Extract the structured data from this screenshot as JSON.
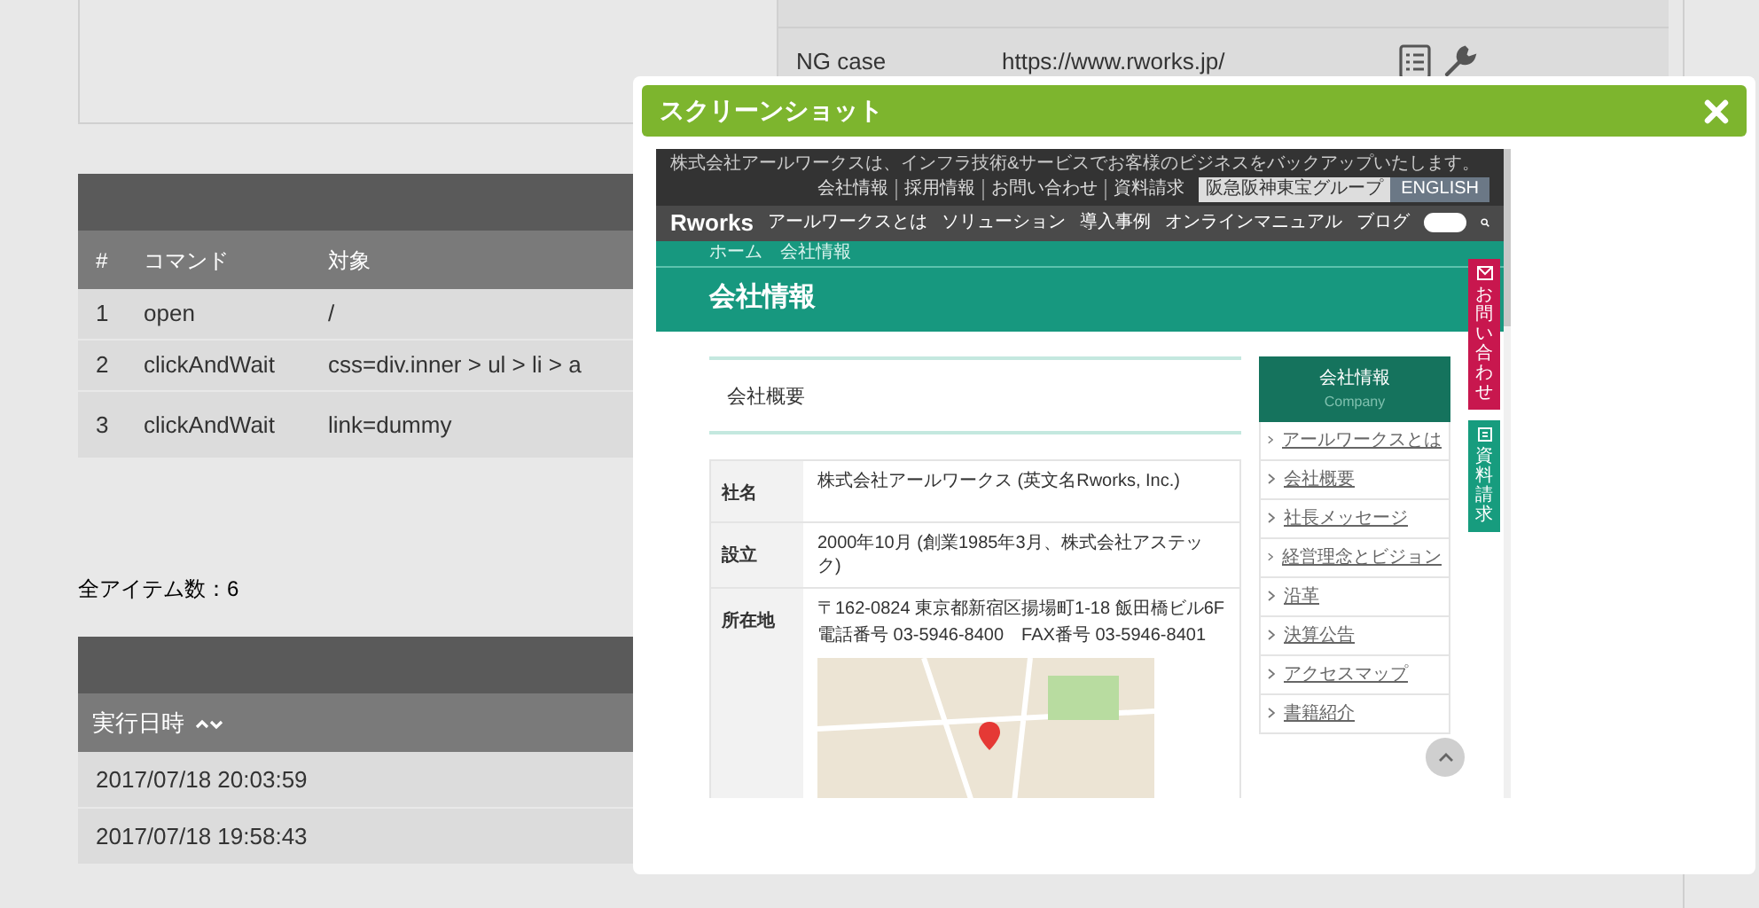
{
  "background": {
    "results_table": {
      "rows": [
        {
          "name": "NG case",
          "url": "https://www.rworks.jp/"
        }
      ]
    },
    "command_table": {
      "columns": [
        "#",
        "コマンド",
        "対象"
      ],
      "rows": [
        [
          "1",
          "open",
          "/"
        ],
        [
          "2",
          "clickAndWait",
          "css=div.inner > ul > li > a"
        ],
        [
          "3",
          "clickAndWait",
          "link=dummy"
        ]
      ]
    },
    "item_count": "全アイテム数：6",
    "history_table": {
      "columns": [
        "実行日時"
      ],
      "rows": [
        [
          "2017/07/18 20:03:59"
        ],
        [
          "2017/07/18 19:58:43"
        ]
      ]
    }
  },
  "dialog": {
    "title": "スクリーンショット",
    "screenshot": {
      "tagline": "株式会社アールワークスは、インフラ技術&サービスでお客様のビジネスをバックアップいたします。",
      "top_links": [
        "会社情報",
        "採用情報",
        "お問い合わせ",
        "資料請求"
      ],
      "group_link": "阪急阪神東宝グループ",
      "english_link": "ENGLISH",
      "logo": "Rworks",
      "nav": [
        "アールワークスとは",
        "ソリューション",
        "導入事例",
        "オンラインマニュアル",
        "ブログ"
      ],
      "breadcrumb": [
        "ホーム",
        "会社情報"
      ],
      "page_title": "会社情報",
      "side_tabs": [
        "お問い合わせ",
        "資料請求"
      ],
      "section_title": "会社概要",
      "profile": [
        {
          "label": "社名",
          "lines": [
            "株式会社アールワークス (英文名Rworks, Inc.)"
          ]
        },
        {
          "label": "設立",
          "lines": [
            "2000年10月 (創業1985年3月、株式会社アステック)"
          ]
        },
        {
          "label": "所在地",
          "lines": [
            "〒162-0824 東京都新宿区揚場町1-18 飯田橋ビル6F",
            "電話番号 03-5946-8400　FAX番号 03-5946-8401"
          ]
        }
      ],
      "sidebar": {
        "title": "会社情報",
        "subtitle": "Company",
        "items": [
          "アールワークスとは",
          "会社概要",
          "社長メッセージ",
          "経営理念とビジョン",
          "沿革",
          "決算公告",
          "アクセスマップ",
          "書籍紹介"
        ]
      }
    }
  }
}
